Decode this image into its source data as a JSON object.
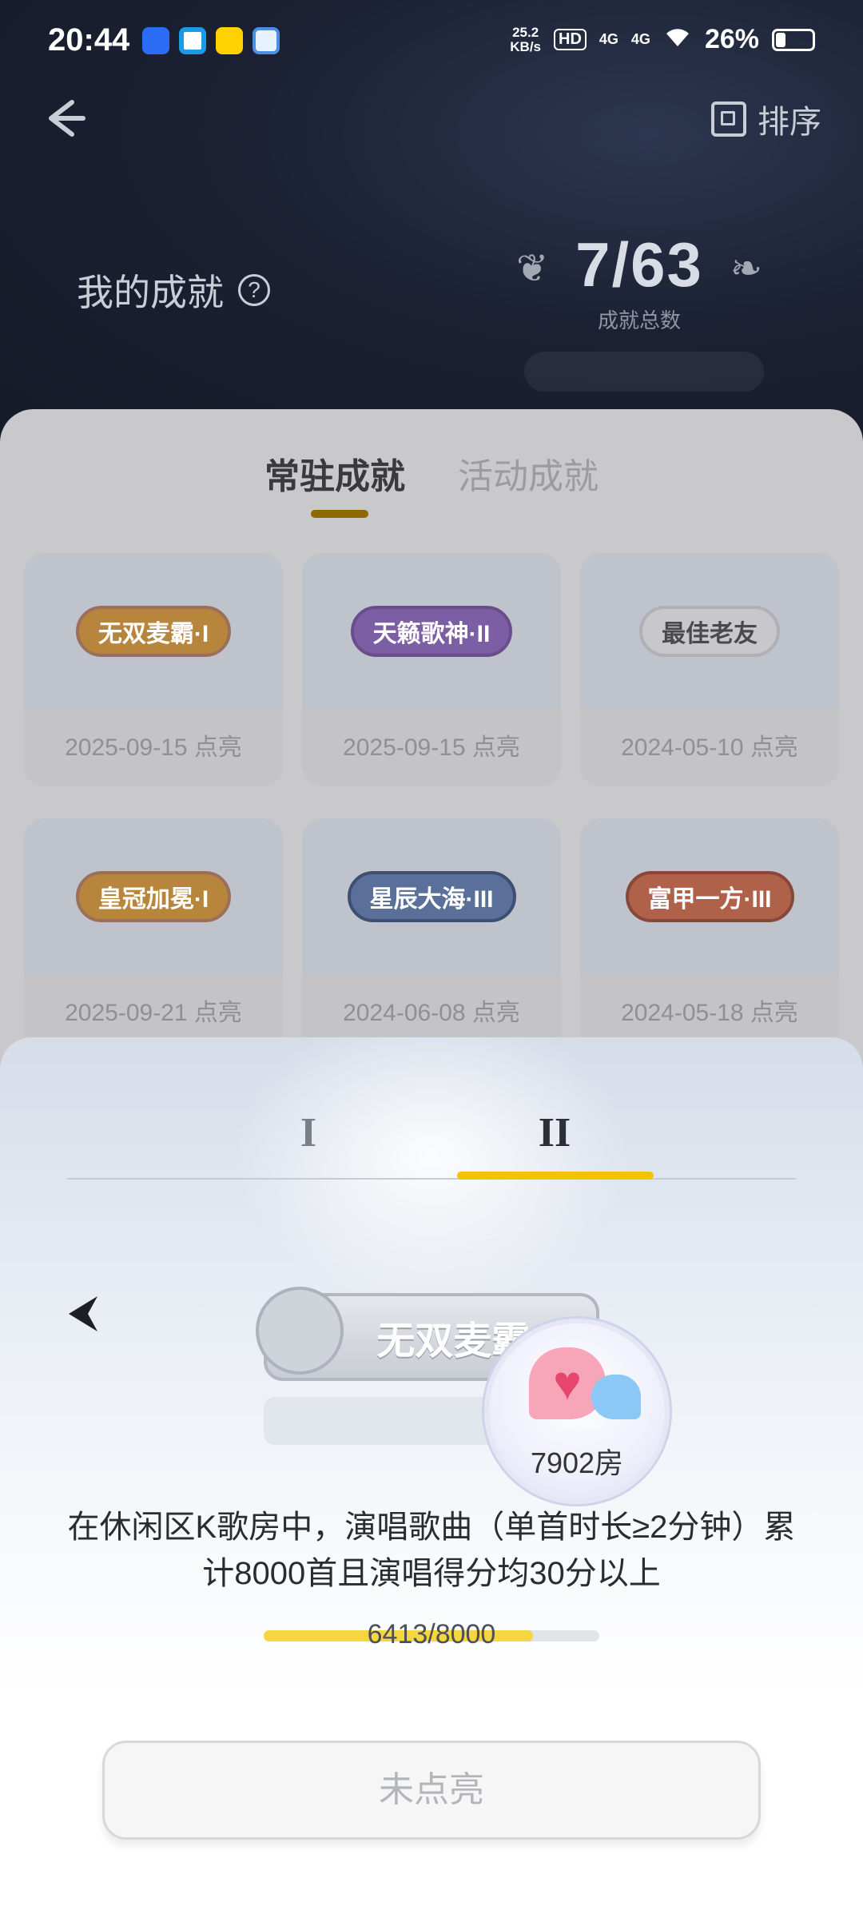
{
  "status_bar": {
    "time": "20:44",
    "speed_value": "25.2",
    "speed_unit": "KB/s",
    "hd": "HD",
    "sig1": "4G",
    "sig2": "4G",
    "battery_pct": "26%",
    "apps": [
      "app-icon-1",
      "app-icon-2",
      "meituan-icon",
      "app-icon-4"
    ]
  },
  "header": {
    "back_icon": "arrow-left-icon",
    "sort_label": "排序",
    "my_title": "我的成就",
    "help_icon": "?",
    "total": "7/63",
    "total_label": "成就总数"
  },
  "tabs": {
    "permanent": "常驻成就",
    "event": "活动成就"
  },
  "achievements": [
    {
      "name": "无双麦霸·I",
      "date": "2025-09-15 点亮"
    },
    {
      "name": "天籁歌神·II",
      "date": "2025-09-15 点亮"
    },
    {
      "name": "最佳老友",
      "date": "2024-05-10 点亮"
    },
    {
      "name": "皇冠加冕·I",
      "date": "2025-09-21 点亮"
    },
    {
      "name": "星辰大海·III",
      "date": "2024-06-08 点亮"
    },
    {
      "name": "富甲一方·III",
      "date": "2024-05-18 点亮"
    }
  ],
  "sheet": {
    "level_tabs": [
      "I",
      "II"
    ],
    "active_level": 1,
    "badge_name": "无双麦霸·II",
    "room_label": "7902房",
    "description_line1": "在休闲区K歌房中，演唱歌曲（单首时长≥2分钟）累",
    "description_line2": "计8000首且演唱得分均30分以上",
    "progress_current": 6413,
    "progress_total": 8000,
    "progress_text": "6413/8000",
    "action_label": "未点亮"
  },
  "colors": {
    "header_bg": "#1b2133",
    "accent_yellow": "#f2c400",
    "tab_indicator": "#8c6a00"
  }
}
